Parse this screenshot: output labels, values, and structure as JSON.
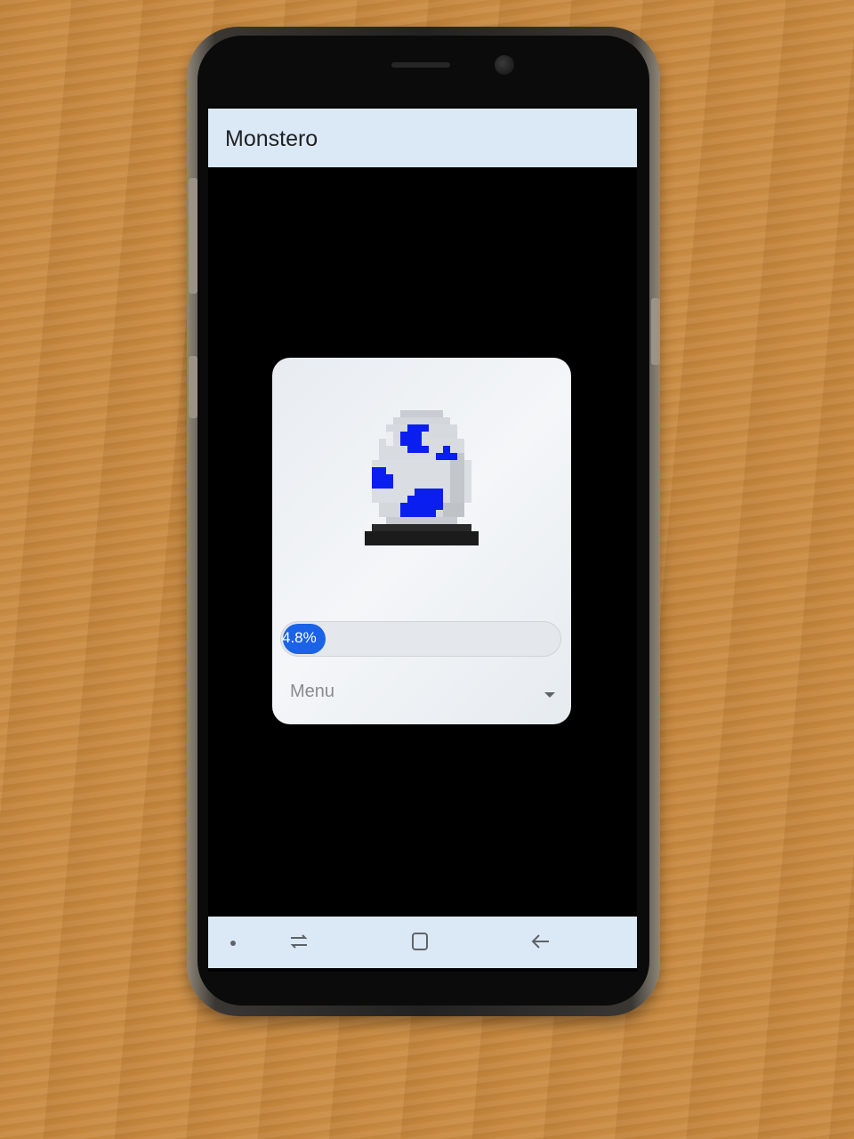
{
  "app": {
    "title": "Monstero"
  },
  "egg_card": {
    "sprite_icon": "pixel-egg-with-blue-spots",
    "spot_color": "#0b1ef0",
    "progress": {
      "label": "4.8%",
      "value_percent": 4.8,
      "fill_color": "#1a63e6"
    },
    "menu": {
      "selected": "Menu"
    }
  },
  "nav_bar": {
    "icons": [
      "dot-icon",
      "recent-apps-icon",
      "home-icon",
      "back-icon"
    ]
  },
  "colors": {
    "app_bar": "#dbe9f6",
    "screen": "#000000"
  }
}
